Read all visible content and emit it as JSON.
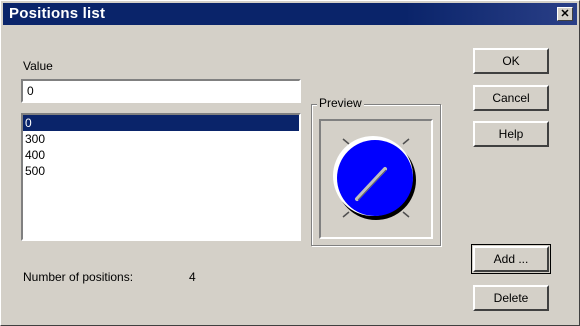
{
  "window": {
    "title": "Positions list",
    "close_glyph": "✕"
  },
  "value": {
    "label": "Value",
    "current": "0"
  },
  "positions": {
    "items": [
      "0",
      "300",
      "400",
      "500"
    ],
    "selected_index": 0
  },
  "preview": {
    "label": "Preview",
    "knob_color": "#0000ff"
  },
  "buttons": {
    "ok": "OK",
    "cancel": "Cancel",
    "help": "Help",
    "add": "Add ...",
    "delete": "Delete"
  },
  "summary": {
    "label": "Number of positions:",
    "count": "4"
  },
  "colors": {
    "titlebar": "#0a246a",
    "selection": "#0a246a",
    "face": "#d4d0c8"
  }
}
